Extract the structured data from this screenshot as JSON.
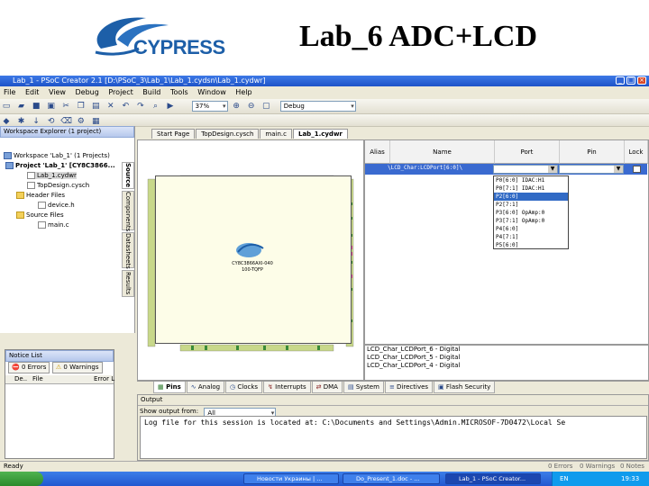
{
  "slide": {
    "logo_text": "CYPRESS",
    "title": "Lab_6 ADC+LCD"
  },
  "window": {
    "title": "Lab_1 - PSoC Creator 2.1  [D:\\PSoC_3\\Lab_1\\Lab_1.cydsn\\Lab_1.cydwr]",
    "min": "_",
    "max": "□",
    "close": "×"
  },
  "menu": [
    "File",
    "Edit",
    "View",
    "Debug",
    "Project",
    "Build",
    "Tools",
    "Window",
    "Help"
  ],
  "toolbar": {
    "zoom": "37%",
    "config": "Debug"
  },
  "explorer": {
    "title": "Workspace Explorer (1 project)",
    "workspace": "Workspace 'Lab_1' (1 Projects)",
    "project": "Project 'Lab_1' [CY8C3866...",
    "cydwr": "Lab_1.cydwr",
    "topdesign": "TopDesign.cysch",
    "header_folder": "Header Files",
    "device_h": "device.h",
    "source_folder": "Source Files",
    "main_c": "main.c",
    "tabs": [
      "Source",
      "Components",
      "Datasheets",
      "Results"
    ]
  },
  "notice": {
    "title": "Notice List",
    "errors": "0 Errors",
    "warnings": "0 Warnings",
    "col_desc": "De..",
    "col_file": "File",
    "col_error": "Error L"
  },
  "doc_tabs": [
    "Start Page",
    "TopDesign.cysch",
    "main.c",
    "Lab_1.cydwr"
  ],
  "chip": {
    "name": "CY8C3866AXI-040",
    "package": "100-TQFP"
  },
  "pin_table": {
    "headers": [
      "Alias",
      "Name",
      "Port",
      "Pin",
      "Lock"
    ],
    "row_name": "\\LCD_Char:LCDPort[6:0]\\",
    "port_options": [
      "P0[6:0] IDAC:H1",
      "P0[7:1] IDAC:H1",
      "P2[6:0]",
      "P2[7:1]",
      "P3[6:0] OpAmp:0",
      "P3[7:1] OpAmp:0",
      "P4[6:0]",
      "P4[7:1]",
      "P5[6:0]"
    ]
  },
  "net_list": [
    "LCD_Char_LCDPort_6 - Digital",
    "LCD_Char_LCDPort_5 - Digital",
    "LCD_Char_LCDPort_4 - Digital"
  ],
  "bottom_tabs": [
    "Pins",
    "Analog",
    "Clocks",
    "Interrupts",
    "DMA",
    "System",
    "Directives",
    "Flash Security"
  ],
  "output": {
    "title": "Output",
    "show_label": "Show output from:",
    "source": "All",
    "log": "Log file for this session is located at: C:\\Documents and Settings\\Admin.MICROSOF-7D0472\\Local Se"
  },
  "status": {
    "ready": "Ready",
    "errors": "0 Errors",
    "warnings": "0 Warnings",
    "notes": "0 Notes"
  },
  "taskbar": {
    "items": [
      "Новости Украины | ...",
      "Do_Present_1.doc - ...",
      "Lab_1 - PSoC Creator..."
    ],
    "lang": "EN",
    "time": "19:33"
  }
}
